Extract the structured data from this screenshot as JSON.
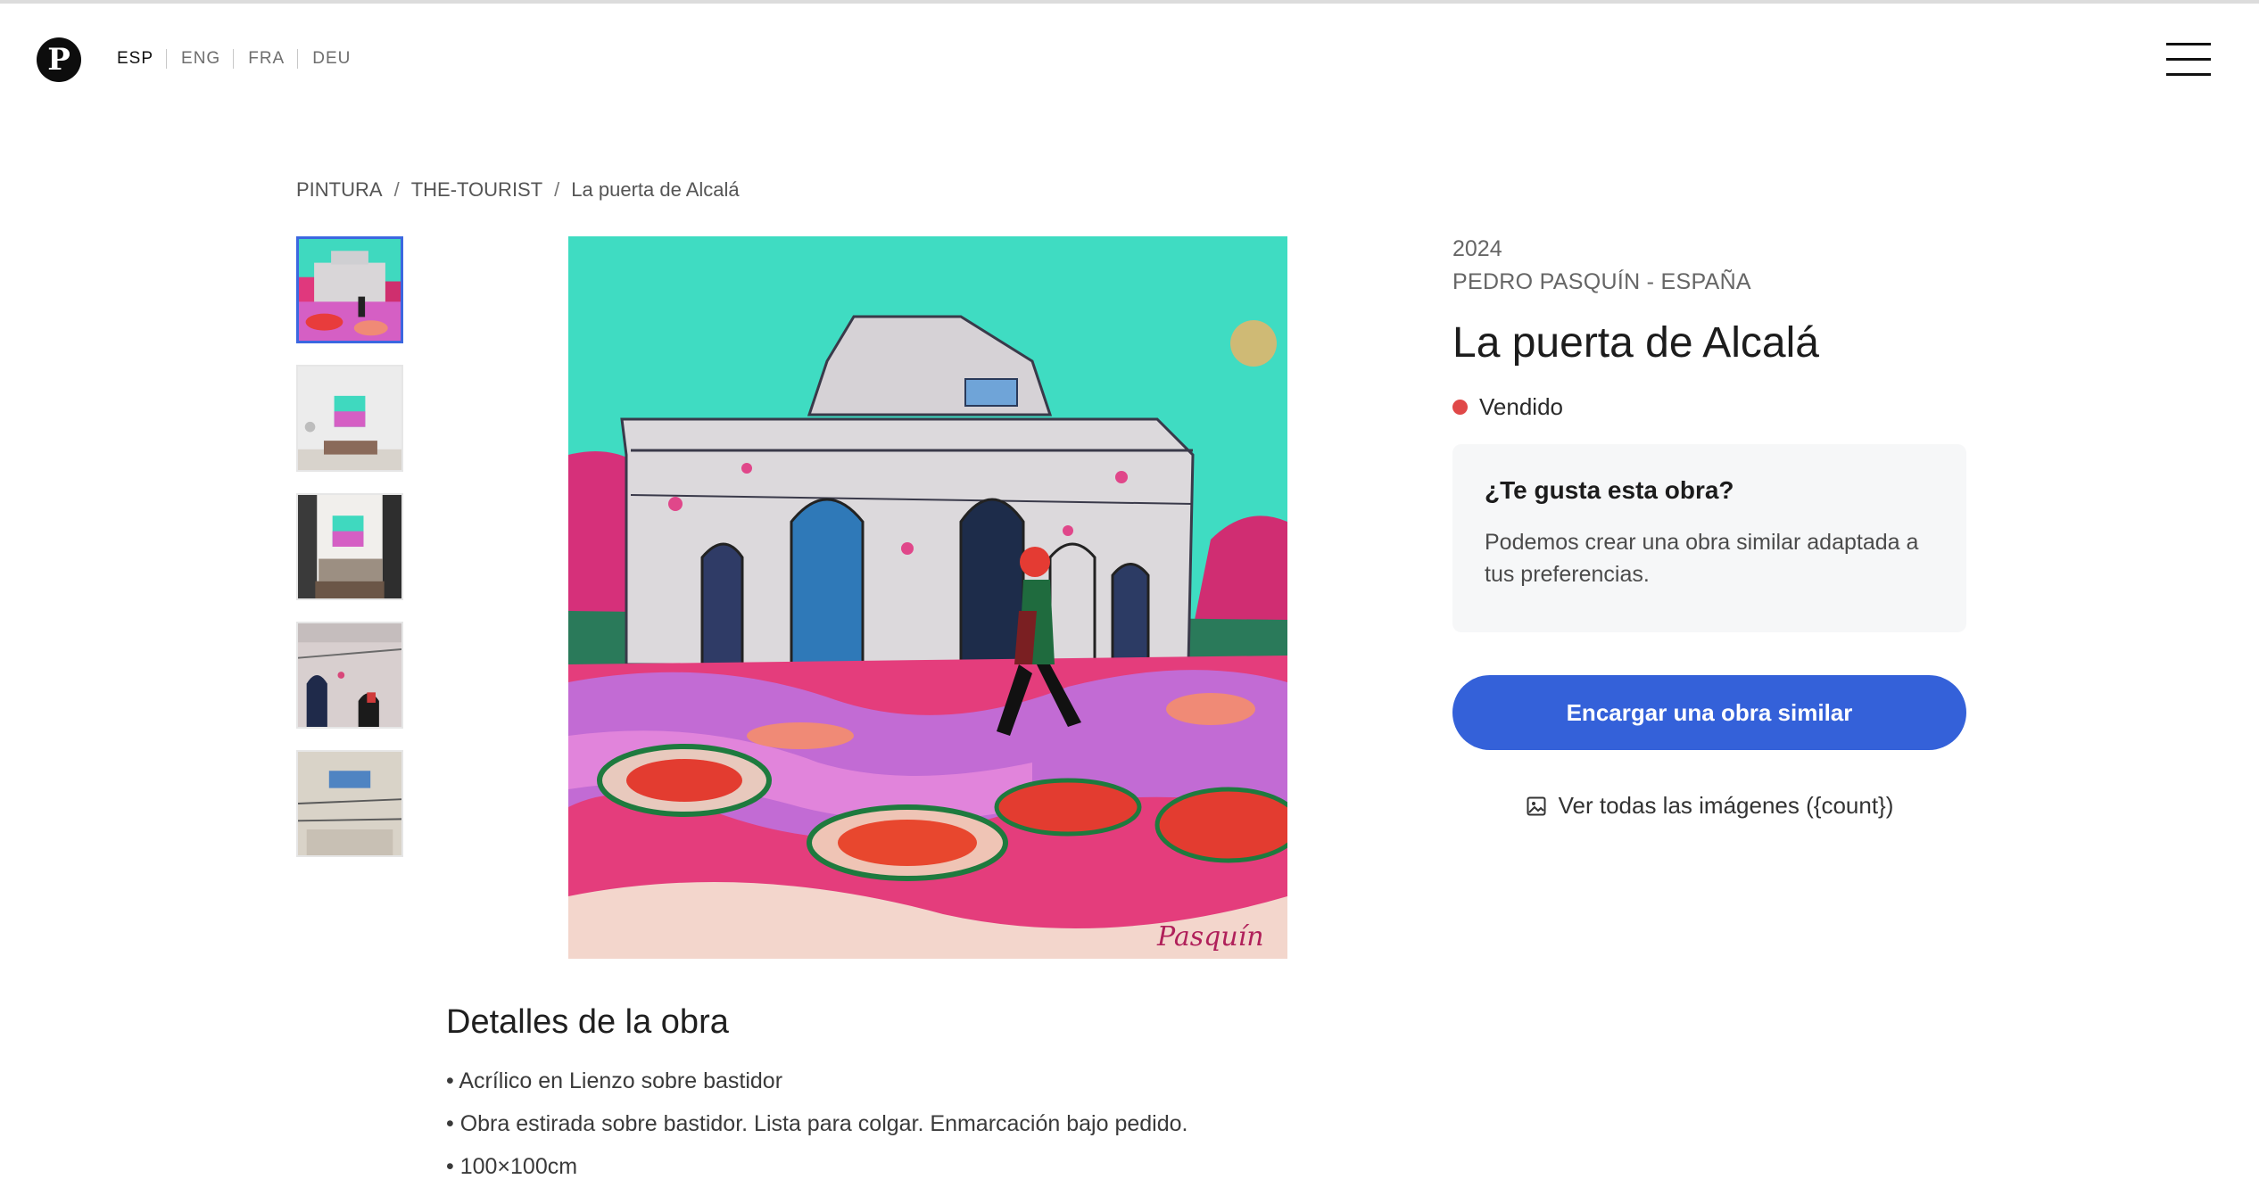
{
  "header": {
    "logo_letter": "P",
    "languages": [
      "ESP",
      "ENG",
      "FRA",
      "DEU"
    ],
    "active_language": "ESP"
  },
  "breadcrumb": [
    "PINTURA",
    "THE-TOURIST",
    "La puerta de Alcalá"
  ],
  "gallery": {
    "thumbnail_count": 5,
    "active_thumbnail": 1,
    "thumbnails": [
      "painting-full",
      "room-wall-mockup",
      "living-room-mockup",
      "detail-arch",
      "detail-top"
    ]
  },
  "artwork": {
    "year": "2024",
    "artist": "PEDRO PASQUÍN - ESPAÑA",
    "title": "La puerta de Alcalá",
    "status": "Vendido",
    "status_color": "#e04848",
    "signature": "Pasquín"
  },
  "card": {
    "title": "¿Te gusta esta obra?",
    "text": "Podemos crear una obra similar adaptada a tus preferencias."
  },
  "cta": {
    "label": "Encargar una obra similar",
    "color": "#3461d9"
  },
  "view_all": {
    "label": "Ver todas las imágenes ({count})",
    "icon": "image-icon"
  },
  "details": {
    "title": "Detalles de la obra",
    "items": [
      "Acrílico en Lienzo sobre bastidor",
      "Obra estirada sobre bastidor. Lista para colgar. Enmarcación bajo pedido.",
      "100×100cm"
    ]
  },
  "menu": {
    "icon": "hamburger-menu-icon"
  }
}
